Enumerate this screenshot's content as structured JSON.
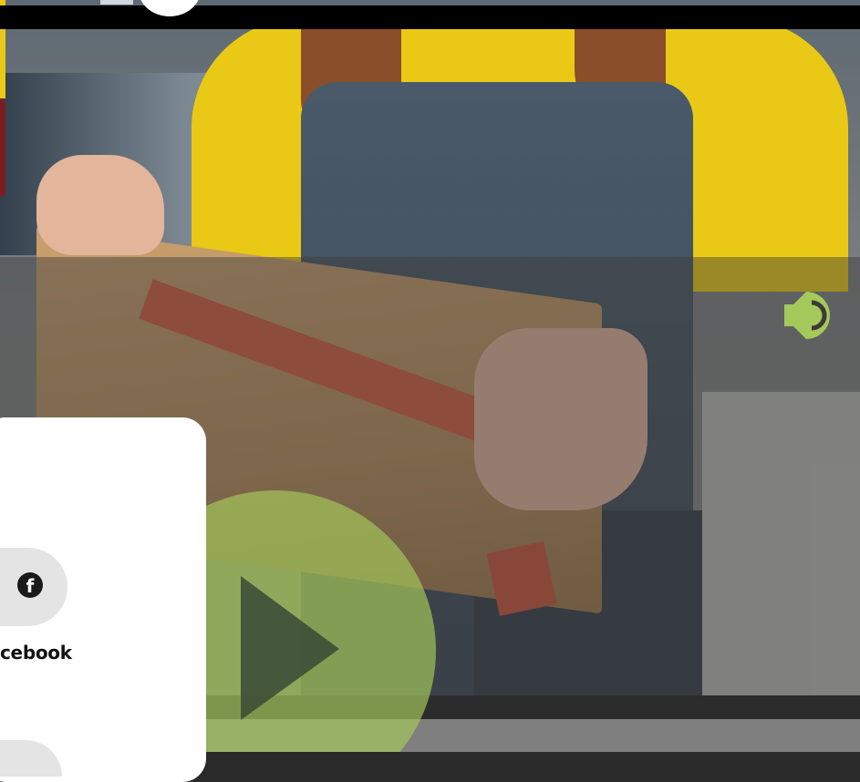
{
  "video": {
    "scene": "person-opening-amazon-box",
    "controls": {
      "volume_icon": "volume-icon",
      "play_icon": "play-icon",
      "accent_color": "#a5c85a"
    }
  },
  "share": {
    "items": [
      {
        "icon": "facebook-icon",
        "label": "cebook"
      }
    ]
  },
  "colors": {
    "top_bar": "#000000",
    "card": "#ffffff",
    "icon_bg": "#e4e4e4",
    "tshirt": "#e9c915"
  }
}
